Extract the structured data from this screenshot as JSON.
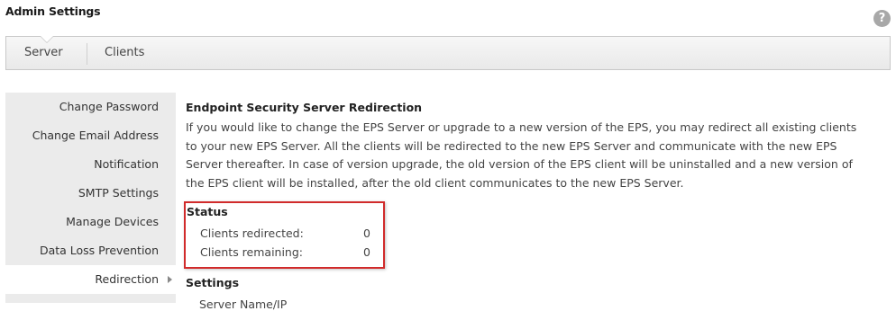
{
  "page": {
    "title": "Admin Settings",
    "help_icon": "?"
  },
  "tabs": [
    {
      "label": "Server",
      "active": true
    },
    {
      "label": "Clients",
      "active": false
    }
  ],
  "sidebar": {
    "items": [
      {
        "label": "Change Password"
      },
      {
        "label": "Change Email Address"
      },
      {
        "label": "Notification"
      },
      {
        "label": "SMTP Settings"
      },
      {
        "label": "Manage Devices"
      },
      {
        "label": "Data Loss Prevention"
      },
      {
        "label": "Redirection",
        "active": true
      }
    ]
  },
  "content": {
    "title": "Endpoint Security Server Redirection",
    "description": "If you would like to change the EPS Server or upgrade to a new version of the EPS, you may redirect all existing clients to your new EPS Server. All the clients will be redirected to the new EPS Server and communicate with the new EPS Server thereafter. In case of version upgrade, the old version of the EPS client will be uninstalled and a new version of the EPS client will be installed, after the old client communicates to the new EPS Server.",
    "status": {
      "heading": "Status",
      "rows": [
        {
          "label": "Clients redirected:",
          "value": "0"
        },
        {
          "label": "Clients remaining:",
          "value": "0"
        }
      ]
    },
    "settings": {
      "heading": "Settings",
      "partial_row": "Server Name/IP"
    }
  },
  "colors": {
    "highlight_border": "#d12b2b",
    "sidebar_bg": "#ebebeb",
    "tab_bar_bg": "#efefef",
    "help_icon_bg": "#a8a8a8"
  }
}
